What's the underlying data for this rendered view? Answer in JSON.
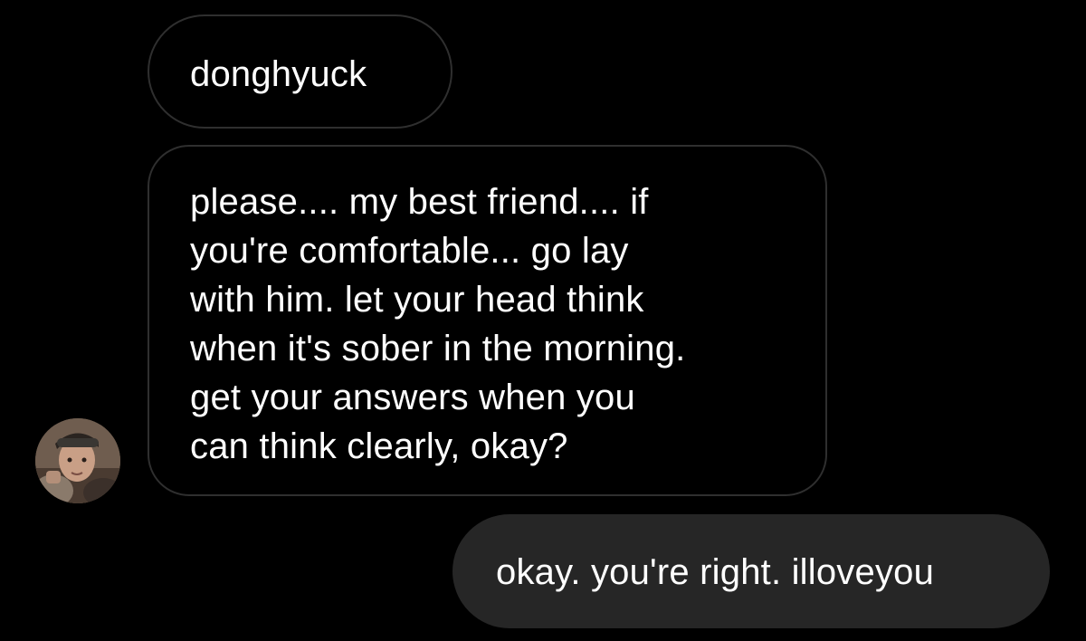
{
  "messages": [
    {
      "sender": "contact",
      "text": "donghyuck"
    },
    {
      "sender": "contact",
      "lines": [
        "please.... my best friend.... if",
        "you're comfortable... go lay",
        "with him. let your head think",
        "when it's sober in the morning.",
        "get your answers when you",
        "can think clearly, okay?"
      ]
    },
    {
      "sender": "me",
      "text": "okay. you're right. illoveyou"
    }
  ],
  "avatar": {
    "icon": "profile-photo"
  },
  "colors": {
    "background": "#000000",
    "incoming_border": "#2f2f2f",
    "outgoing_bubble": "#262626",
    "text": "#ffffff"
  }
}
